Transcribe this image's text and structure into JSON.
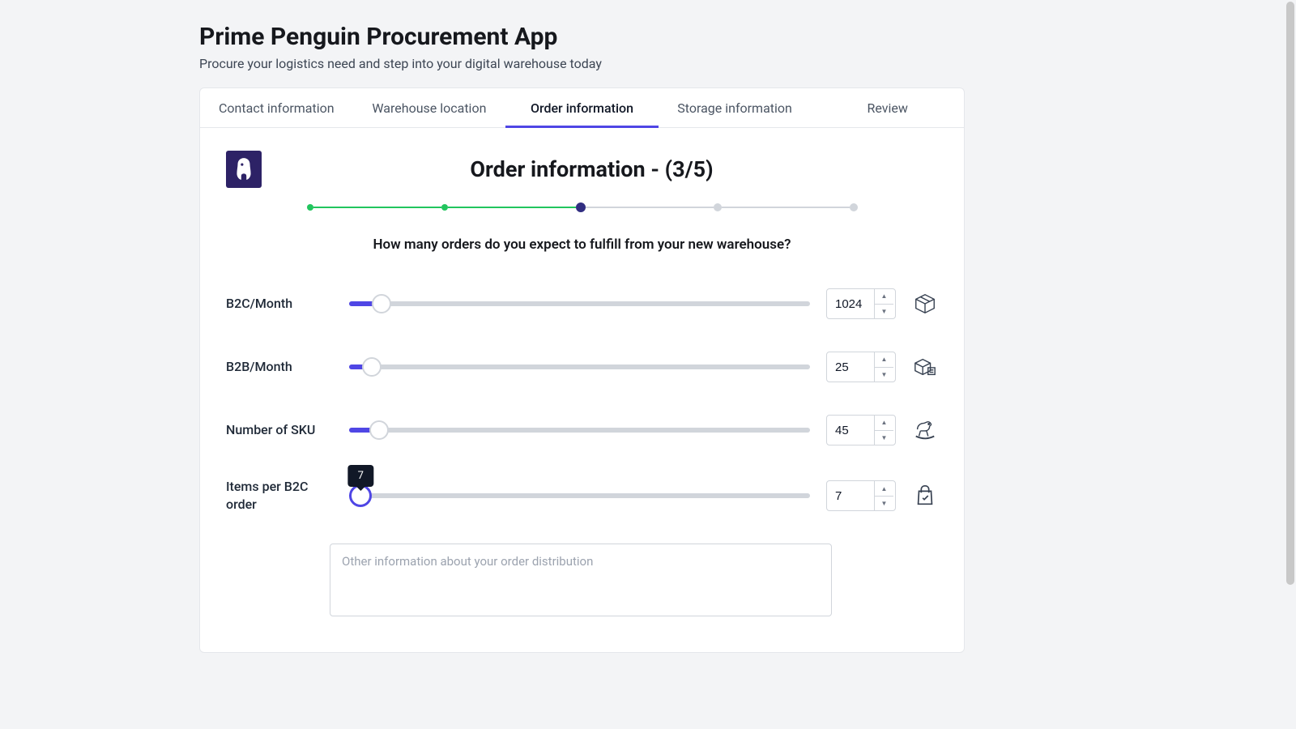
{
  "header": {
    "title": "Prime Penguin Procurement App",
    "subtitle": "Procure your logistics need and step into your digital warehouse today"
  },
  "tabs": [
    {
      "label": "Contact information",
      "active": false
    },
    {
      "label": "Warehouse location",
      "active": false
    },
    {
      "label": "Order information",
      "active": true
    },
    {
      "label": "Storage information",
      "active": false
    },
    {
      "label": "Review",
      "active": false
    }
  ],
  "content": {
    "page_title": "Order information - (3/5)",
    "question": "How many orders do you expect to fulfill from your new warehouse?",
    "rows": {
      "b2c": {
        "label": "B2C/Month",
        "value": "1024",
        "fill_pct": 7
      },
      "b2b": {
        "label": "B2B/Month",
        "value": "25",
        "fill_pct": 5
      },
      "sku": {
        "label": "Number of SKU",
        "value": "45",
        "fill_pct": 6.5
      },
      "items": {
        "label": "Items per B2C order",
        "value": "7",
        "tooltip": "7",
        "fill_pct": 2.5,
        "active": true
      }
    },
    "textarea_placeholder": "Other information about your order distribution"
  }
}
